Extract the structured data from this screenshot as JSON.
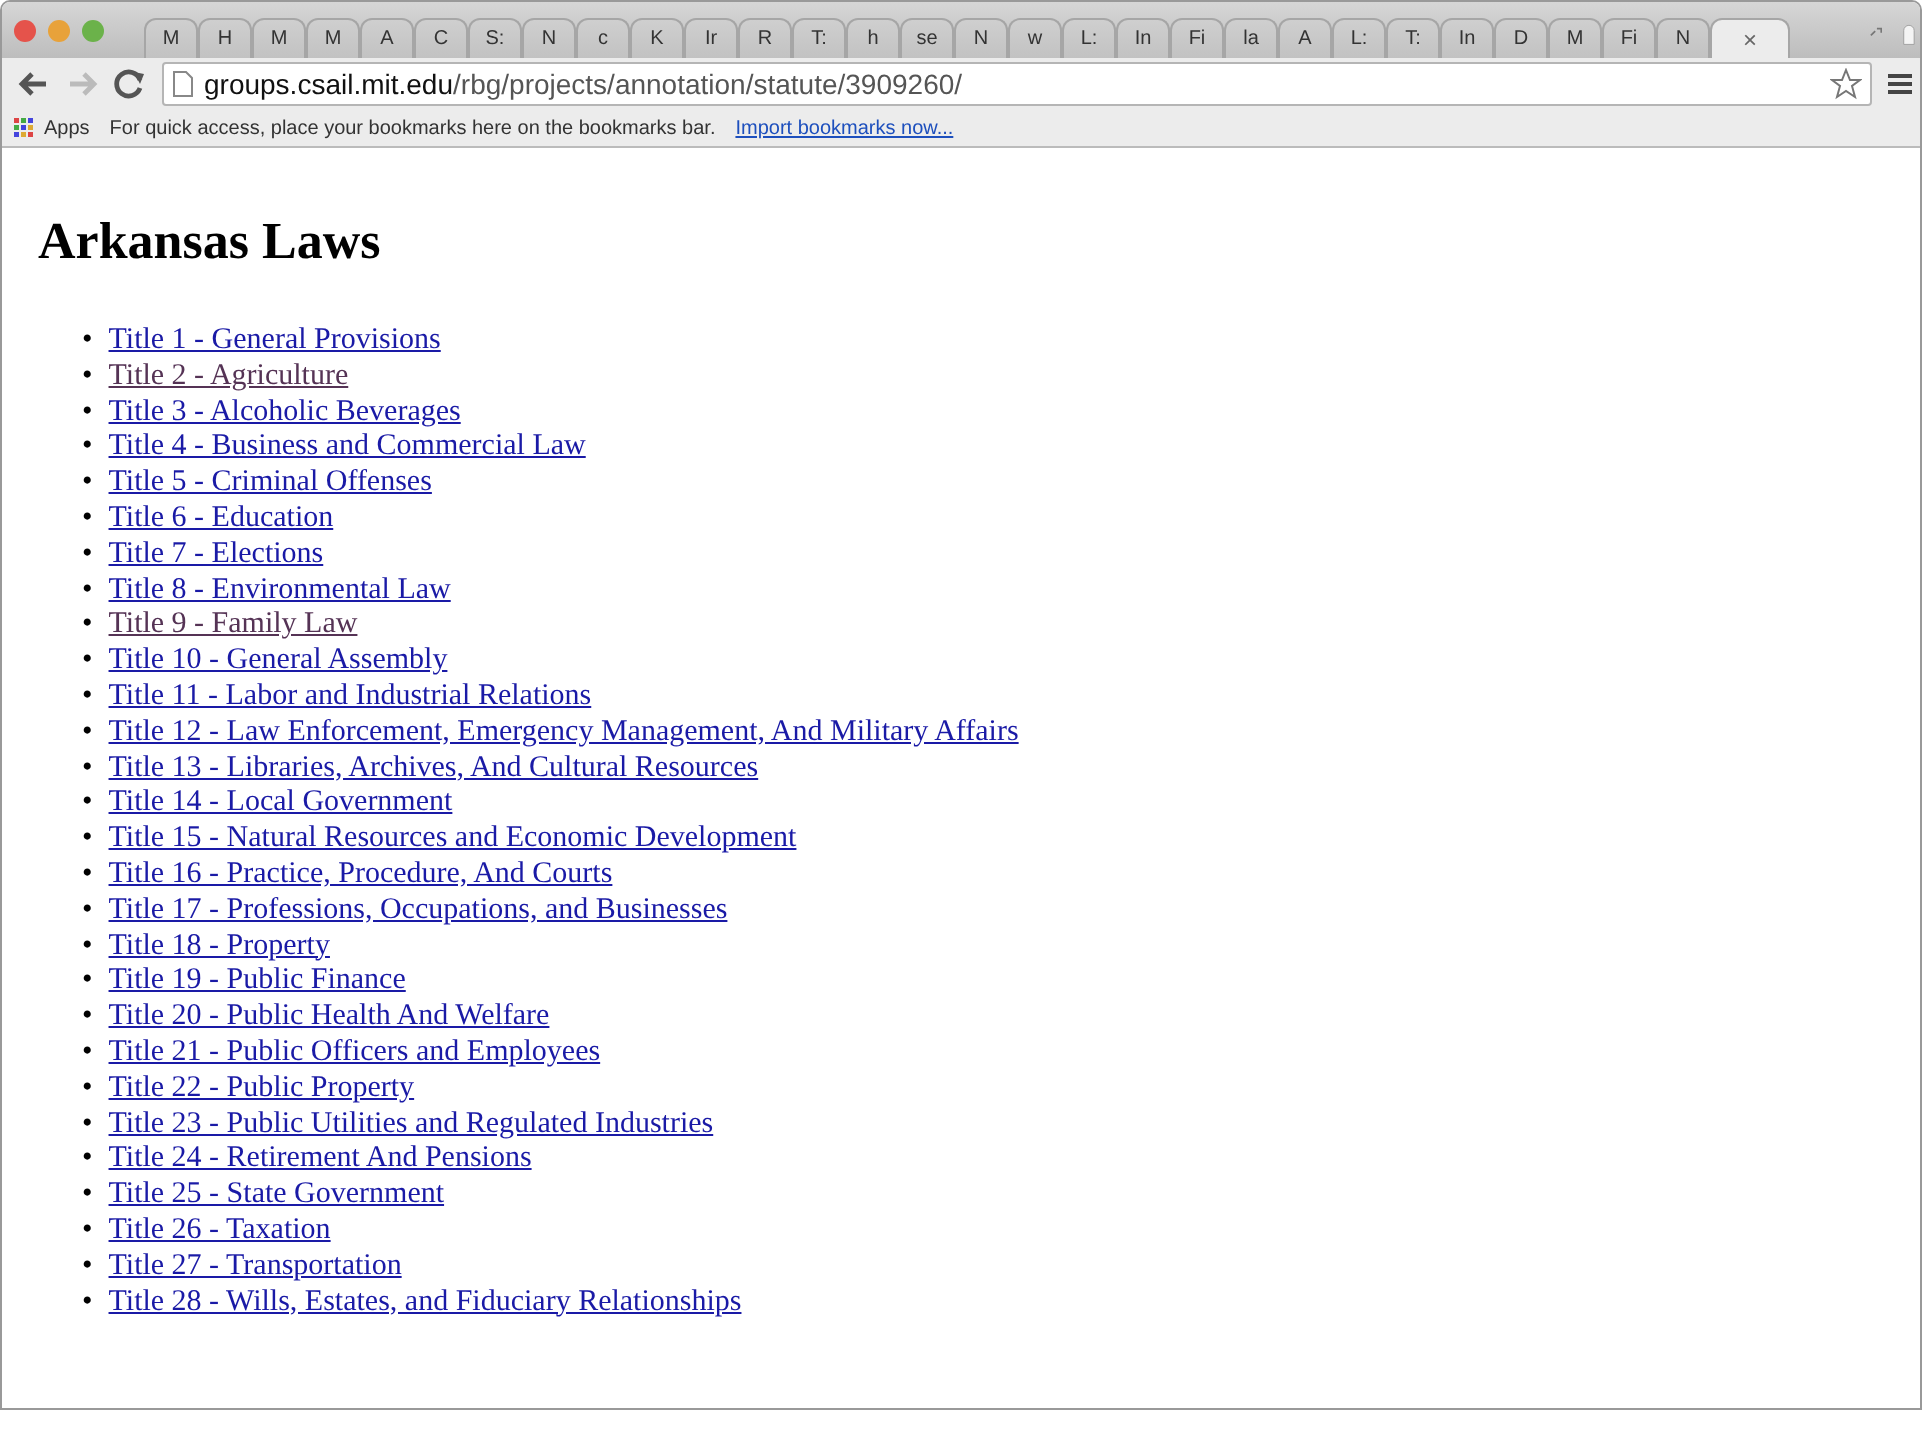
{
  "tabs": [
    {
      "label": "M",
      "selected": false
    },
    {
      "label": "H",
      "selected": false
    },
    {
      "label": "M",
      "selected": false
    },
    {
      "label": "M",
      "selected": false
    },
    {
      "label": "A",
      "selected": false
    },
    {
      "label": "C",
      "selected": false
    },
    {
      "label": "S:",
      "selected": false
    },
    {
      "label": "N",
      "selected": false
    },
    {
      "label": "c",
      "selected": false
    },
    {
      "label": "K",
      "selected": false
    },
    {
      "label": "Ir",
      "selected": false
    },
    {
      "label": "R",
      "selected": false
    },
    {
      "label": "T:",
      "selected": false
    },
    {
      "label": "h",
      "selected": false
    },
    {
      "label": "se",
      "selected": false
    },
    {
      "label": "N",
      "selected": false
    },
    {
      "label": "w",
      "selected": false
    },
    {
      "label": "L:",
      "selected": false
    },
    {
      "label": "In",
      "selected": false
    },
    {
      "label": "Fi",
      "selected": false
    },
    {
      "label": "la",
      "selected": false
    },
    {
      "label": "A",
      "selected": false
    },
    {
      "label": "L:",
      "selected": false
    },
    {
      "label": "T:",
      "selected": false
    },
    {
      "label": "In",
      "selected": false
    },
    {
      "label": "D",
      "selected": false
    },
    {
      "label": "M",
      "selected": false
    },
    {
      "label": "Fi",
      "selected": false
    },
    {
      "label": "N",
      "selected": false
    },
    {
      "close": "×",
      "selected": true
    }
  ],
  "address_bar": {
    "host": "groups.csail.mit.edu",
    "path": "/rbg/projects/annotation/statute/3909260/"
  },
  "bookmarks_bar": {
    "apps": "Apps",
    "hint": "For quick access, place your bookmarks here on the bookmarks bar.",
    "import_link": "Import bookmarks now..."
  },
  "page": {
    "heading": "Arkansas Laws",
    "links": [
      {
        "bullet": "•",
        "text": "Title 1 - General Provisions",
        "visited": false
      },
      {
        "bullet": "•",
        "text": "Title 2 - Agriculture",
        "visited": true
      },
      {
        "bullet": "•",
        "text": "Title 3 - Alcoholic Beverages",
        "visited": false
      },
      {
        "bullet": "•",
        "text": "Title 4 - Business and Commercial Law",
        "visited": false
      },
      {
        "bullet": "•",
        "text": "Title 5 - Criminal Offenses",
        "visited": false
      },
      {
        "bullet": "•",
        "text": "Title 6 - Education",
        "visited": false
      },
      {
        "bullet": "•",
        "text": "Title 7 - Elections",
        "visited": false
      },
      {
        "bullet": "•",
        "text": "Title 8 - Environmental Law",
        "visited": false
      },
      {
        "bullet": "•",
        "text": "Title 9 - Family Law",
        "visited": true
      },
      {
        "bullet": "•",
        "text": "Title 10 - General Assembly",
        "visited": false
      },
      {
        "bullet": "•",
        "text": "Title 11 - Labor and Industrial Relations",
        "visited": false
      },
      {
        "bullet": "•",
        "text": "Title 12 - Law Enforcement, Emergency Management, And Military Affairs",
        "visited": false
      },
      {
        "bullet": "•",
        "text": "Title 13 - Libraries, Archives, And Cultural Resources",
        "visited": false
      },
      {
        "bullet": "•",
        "text": "Title 14 - Local Government",
        "visited": false
      },
      {
        "bullet": "•",
        "text": "Title 15 - Natural Resources and Economic Development",
        "visited": false
      },
      {
        "bullet": "•",
        "text": "Title 16 - Practice, Procedure, And Courts",
        "visited": false
      },
      {
        "bullet": "•",
        "text": "Title 17 - Professions, Occupations, and Businesses",
        "visited": false
      },
      {
        "bullet": "•",
        "text": "Title 18 - Property",
        "visited": false
      },
      {
        "bullet": "•",
        "text": "Title 19 - Public Finance",
        "visited": false
      },
      {
        "bullet": "•",
        "text": "Title 20 - Public Health And Welfare",
        "visited": false
      },
      {
        "bullet": "•",
        "text": "Title 21 - Public Officers and Employees",
        "visited": false
      },
      {
        "bullet": "•",
        "text": "Title 22 - Public Property",
        "visited": false
      },
      {
        "bullet": "•",
        "text": "Title 23 - Public Utilities and Regulated Industries",
        "visited": false
      },
      {
        "bullet": "•",
        "text": "Title 24 - Retirement And Pensions",
        "visited": false
      },
      {
        "bullet": "•",
        "text": "Title 25 - State Government",
        "visited": false
      },
      {
        "bullet": "•",
        "text": "Title 26 - Taxation",
        "visited": false
      },
      {
        "bullet": "•",
        "text": "Title 27 - Transportation",
        "visited": false
      },
      {
        "bullet": "•",
        "text": "Title 28 - Wills, Estates, and Fiduciary Relationships",
        "visited": false
      }
    ]
  }
}
